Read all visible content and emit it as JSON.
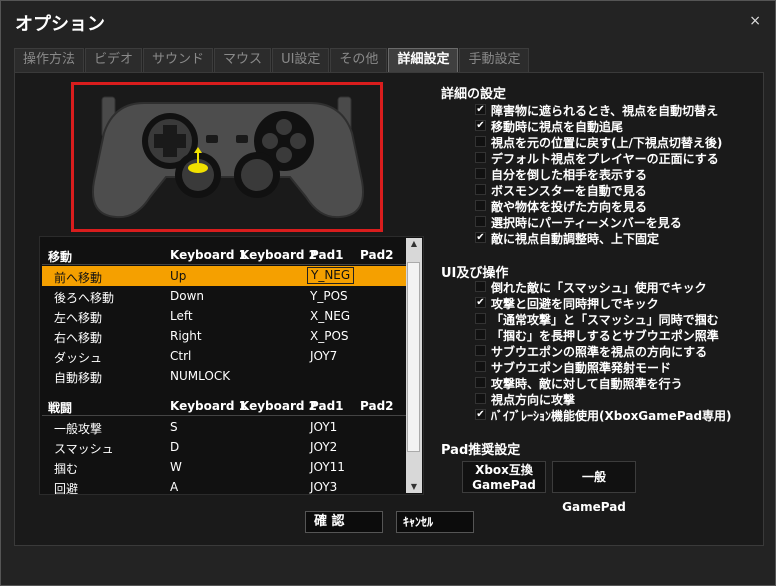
{
  "window": {
    "title": "オプション",
    "close_label": "×"
  },
  "tabs": [
    {
      "label": "操作方法"
    },
    {
      "label": "ビデオ"
    },
    {
      "label": "サウンド"
    },
    {
      "label": "マウス"
    },
    {
      "label": "UI設定"
    },
    {
      "label": "その他"
    },
    {
      "label": "詳細設定"
    },
    {
      "label": "手動設定"
    }
  ],
  "active_tab": "詳細設定",
  "bindings": {
    "movement": {
      "header": [
        "移動",
        "Keyboard 1",
        "Keyboard 2",
        "Pad1",
        "Pad2"
      ],
      "rows": [
        {
          "action": "前へ移動",
          "kb1": "Up",
          "kb2": "",
          "pad1": "Y_NEG",
          "pad2": "",
          "selected": true
        },
        {
          "action": "後ろへ移動",
          "kb1": "Down",
          "kb2": "",
          "pad1": "Y_POS",
          "pad2": ""
        },
        {
          "action": "左へ移動",
          "kb1": "Left",
          "kb2": "",
          "pad1": "X_NEG",
          "pad2": ""
        },
        {
          "action": "右へ移動",
          "kb1": "Right",
          "kb2": "",
          "pad1": "X_POS",
          "pad2": ""
        },
        {
          "action": "ダッシュ",
          "kb1": "Ctrl",
          "kb2": "",
          "pad1": "JOY7",
          "pad2": ""
        },
        {
          "action": "自動移動",
          "kb1": "NUMLOCK",
          "kb2": "",
          "pad1": "",
          "pad2": ""
        }
      ]
    },
    "combat": {
      "header": [
        "戦闘",
        "Keyboard 1",
        "Keyboard 2",
        "Pad1",
        "Pad2"
      ],
      "rows": [
        {
          "action": "一般攻撃",
          "kb1": "S",
          "kb2": "",
          "pad1": "JOY1",
          "pad2": ""
        },
        {
          "action": "スマッシュ",
          "kb1": "D",
          "kb2": "",
          "pad1": "JOY2",
          "pad2": ""
        },
        {
          "action": "掴む",
          "kb1": "W",
          "kb2": "",
          "pad1": "JOY11",
          "pad2": ""
        },
        {
          "action": "回避",
          "kb1": "A",
          "kb2": "",
          "pad1": "JOY3",
          "pad2": ""
        }
      ]
    }
  },
  "detail": {
    "title": "詳細の設定",
    "items": [
      {
        "label": "障害物に遮られるとき、視点を自動切替え",
        "checked": true
      },
      {
        "label": "移動時に視点を自動追尾",
        "checked": true
      },
      {
        "label": "視点を元の位置に戻す(上/下視点切替え後)",
        "checked": false
      },
      {
        "label": "デフォルト視点をプレイヤーの正面にする",
        "checked": false
      },
      {
        "label": "自分を倒した相手を表示する",
        "checked": false
      },
      {
        "label": "ボスモンスターを自動で見る",
        "checked": false
      },
      {
        "label": "敵や物体を投げた方向を見る",
        "checked": false
      },
      {
        "label": "選択時にパーティーメンバーを見る",
        "checked": false
      },
      {
        "label": "敵に視点自動調整時、上下固定",
        "checked": true
      }
    ]
  },
  "ui": {
    "title": "UI及び操作",
    "items": [
      {
        "label": "倒れた敵に「スマッシュ」使用でキック",
        "checked": false
      },
      {
        "label": "攻撃と回避を同時押しでキック",
        "checked": true
      },
      {
        "label": "「通常攻撃」と「スマッシュ」同時で掴む",
        "checked": false
      },
      {
        "label": "「掴む」を長押しするとサブウエポン照準",
        "checked": false
      },
      {
        "label": "サブウエポンの照準を視点の方向にする",
        "checked": false
      },
      {
        "label": "サブウエポン自動照準発射モード",
        "checked": false
      },
      {
        "label": "攻撃時、敵に対して自動照準を行う",
        "checked": false
      },
      {
        "label": "視点方向に攻撃",
        "checked": false
      },
      {
        "label": "ﾊﾞｲﾌﾞﾚｰｼｮﾝ機能使用(XboxGamePad専用)",
        "checked": true
      }
    ]
  },
  "pad": {
    "title": "Pad推奨設定",
    "xbox_line1": "Xbox互換",
    "xbox_line2": "GamePad",
    "generic": "一般GamePad"
  },
  "buttons": {
    "ok": "確 認",
    "cancel": "ｷｬﾝｾﾙ"
  },
  "colors": {
    "selected_row": "#f5a000",
    "highlight_frame": "#d91d1d",
    "stick_marker": "#f0e000"
  }
}
